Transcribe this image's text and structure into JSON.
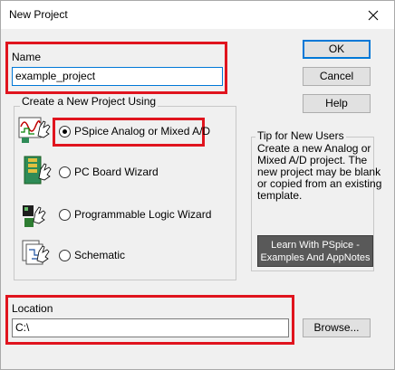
{
  "window": {
    "title": "New Project"
  },
  "buttons": {
    "ok": "OK",
    "cancel": "Cancel",
    "help": "Help",
    "browse": "Browse..."
  },
  "name_field": {
    "label": "Name",
    "value": "example_project"
  },
  "project_type": {
    "group_title": "Create a New Project Using",
    "options": [
      {
        "label": "PSpice Analog or Mixed A/D",
        "checked": true
      },
      {
        "label": "PC Board Wizard",
        "checked": false
      },
      {
        "label": "Programmable Logic Wizard",
        "checked": false
      },
      {
        "label": "Schematic",
        "checked": false
      }
    ]
  },
  "tip": {
    "title": "Tip for New Users",
    "text_lines": [
      "Create a new Analog or",
      "Mixed A/D project.  The",
      "new project may be blank",
      "or copied from an existing",
      "template."
    ],
    "learn_button_lines": [
      "Learn With PSpice -",
      "Examples And AppNotes"
    ]
  },
  "location_field": {
    "label": "Location",
    "value": "C:\\"
  },
  "colors": {
    "highlight": "#e0141e",
    "focus": "#0078d7",
    "dark_button": "#595959"
  }
}
